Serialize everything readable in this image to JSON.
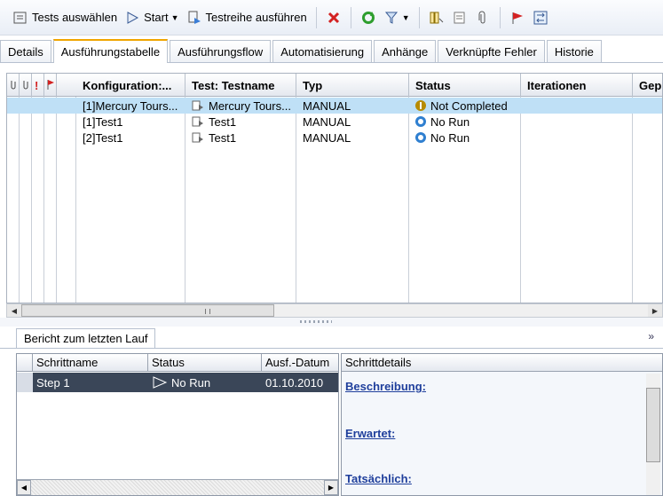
{
  "toolbar": {
    "select_tests": "Tests auswählen",
    "start": "Start",
    "run_test_set": "Testreihe ausführen"
  },
  "tabs": [
    {
      "label": "Details"
    },
    {
      "label": "Ausführungstabelle"
    },
    {
      "label": "Ausführungsflow"
    },
    {
      "label": "Automatisierung"
    },
    {
      "label": "Anhänge"
    },
    {
      "label": "Verknüpfte Fehler"
    },
    {
      "label": "Historie"
    }
  ],
  "grid": {
    "headers": {
      "flag": "!",
      "config": "Konfiguration:...",
      "testname": "Test: Testname",
      "type": "Typ",
      "status": "Status",
      "iterations": "Iterationen",
      "planned": "Gep"
    },
    "rows": [
      {
        "config": "[1]Mercury Tours...",
        "testname": "Mercury Tours...",
        "type": "MANUAL",
        "status": "Not Completed"
      },
      {
        "config": "[1]Test1",
        "testname": "Test1",
        "type": "MANUAL",
        "status": "No Run"
      },
      {
        "config": "[2]Test1",
        "testname": "Test1",
        "type": "MANUAL",
        "status": "No Run"
      }
    ]
  },
  "bottom": {
    "tab": "Bericht zum letzten Lauf",
    "headers": {
      "step": "Schrittname",
      "status": "Status",
      "date": "Ausf.-Datum"
    },
    "row": {
      "step": "Step 1",
      "status": "No Run",
      "date": "01.10.2010"
    },
    "details_title": "Schrittdetails",
    "desc": "Beschreibung:",
    "expected": "Erwartet:",
    "actual": "Tatsächlich:"
  },
  "colors": {
    "selected_row": "#bfe0f6",
    "active_tab_accent": "#f0a500",
    "link": "#1f3f9c"
  }
}
